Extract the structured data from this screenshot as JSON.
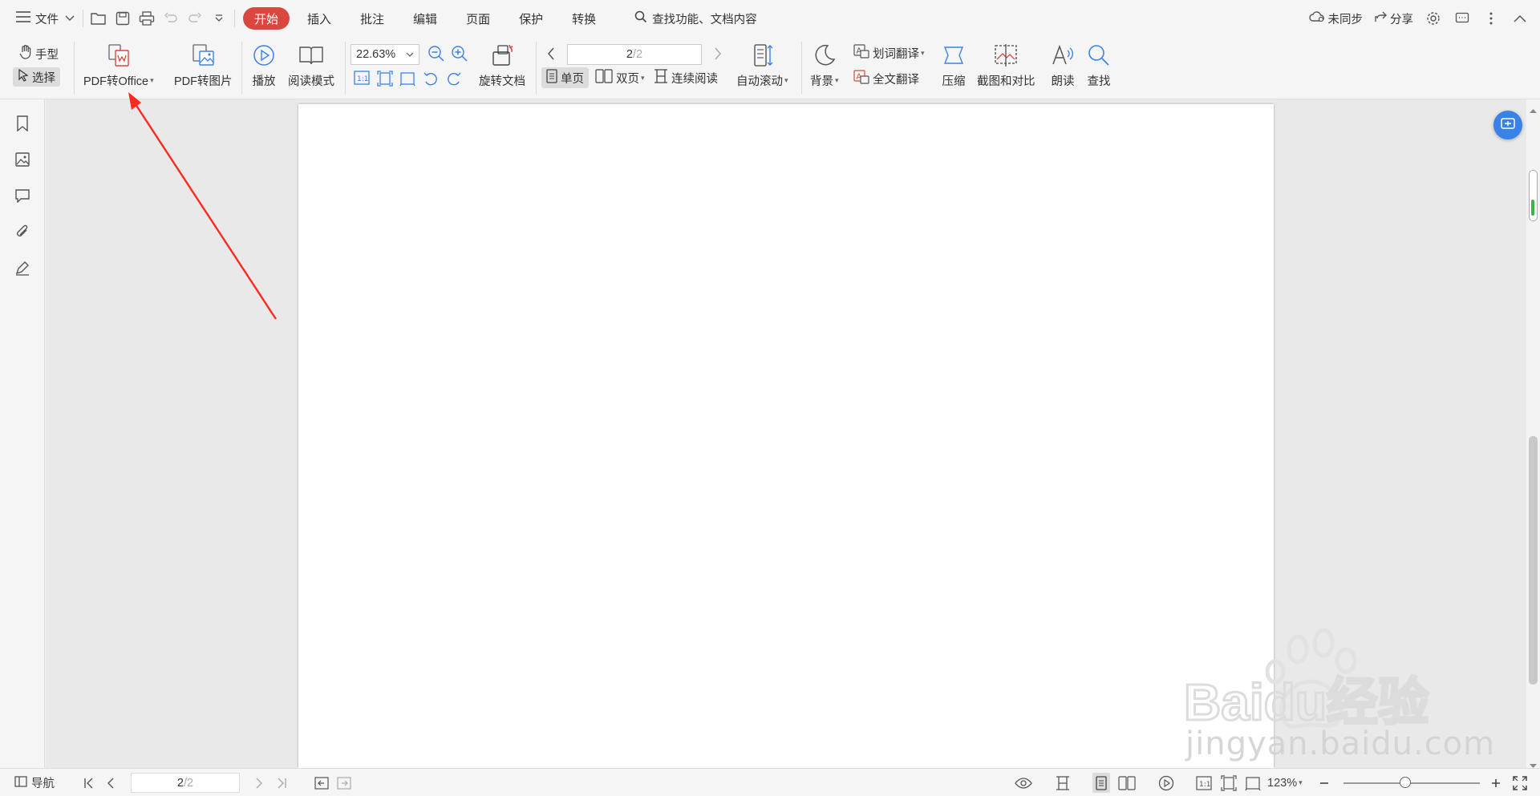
{
  "menubar": {
    "file_label": "文件",
    "tabs": [
      {
        "label": "开始",
        "active": true
      },
      {
        "label": "插入",
        "active": false
      },
      {
        "label": "批注",
        "active": false
      },
      {
        "label": "编辑",
        "active": false
      },
      {
        "label": "页面",
        "active": false
      },
      {
        "label": "保护",
        "active": false
      },
      {
        "label": "转换",
        "active": false
      }
    ],
    "search_label": "查找功能、文档内容",
    "sync_label": "未同步",
    "share_label": "分享"
  },
  "ribbon": {
    "hand_tool": "手型",
    "select_tool": "选择",
    "pdf_to_office": "PDF转Office",
    "pdf_to_image": "PDF转图片",
    "play": "播放",
    "read_mode": "阅读模式",
    "zoom_value": "22.63%",
    "rotate_doc": "旋转文档",
    "page_current": "2",
    "page_total": "/2",
    "single_page": "单页",
    "double_page": "双页",
    "continuous_read": "连续阅读",
    "auto_scroll": "自动滚动",
    "background": "背景",
    "word_translate": "划词翻译",
    "full_translate": "全文翻译",
    "compress": "压缩",
    "screenshot_compare": "截图和对比",
    "read_aloud": "朗读",
    "find": "查找"
  },
  "statusbar": {
    "nav_label": "导航",
    "page_current": "2",
    "page_total": "/2",
    "zoom_label": "123%",
    "zoom_level_fraction": 0.45
  },
  "watermark": {
    "logo_text": "Baidu经验",
    "url_text": "jingyan.baidu.com"
  },
  "colors": {
    "active_tab": "#d9473f",
    "accent_blue": "#3b82e6",
    "arrow_red": "#ff2a1f"
  }
}
